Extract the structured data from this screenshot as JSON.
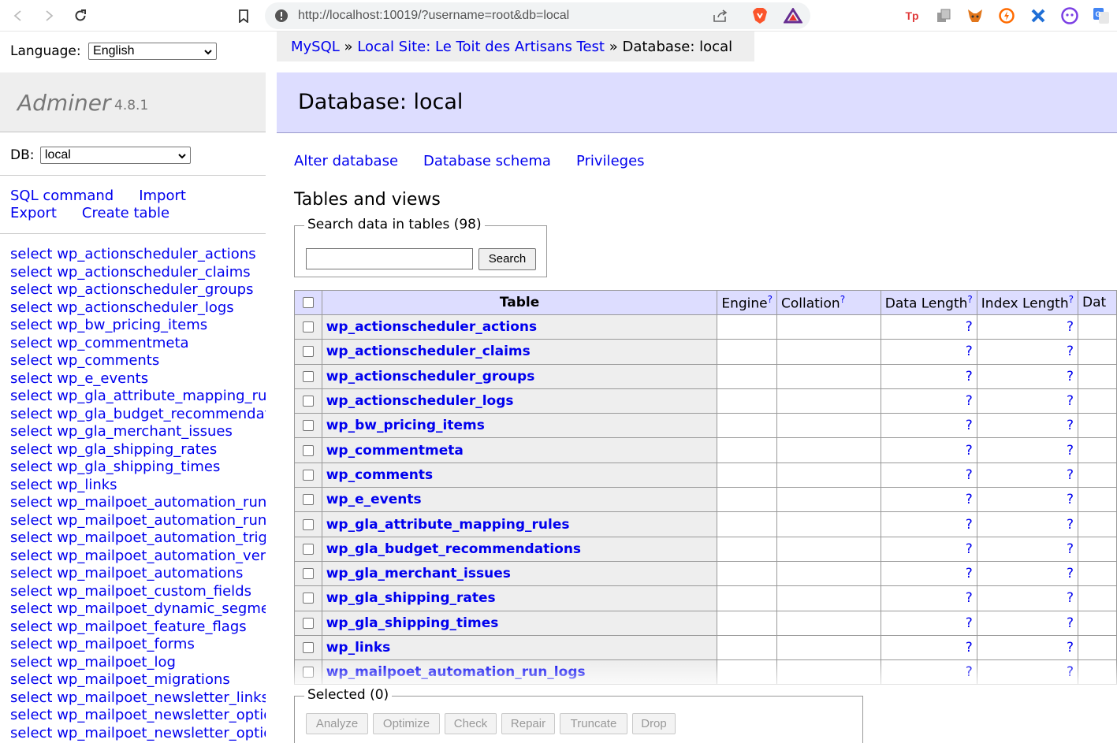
{
  "browser": {
    "url": "http://localhost:10019/?username=root&db=local",
    "extensions": [
      {
        "name": "tp-extension-icon",
        "text": "Tp",
        "color": "#e03a3a"
      },
      {
        "name": "copy-extension-icon",
        "text": "",
        "color": "#8a8a8a"
      },
      {
        "name": "metamask-icon",
        "text": "",
        "color": "#e2761b"
      },
      {
        "name": "orange-extension-icon",
        "text": "",
        "color": "#ff6b00"
      },
      {
        "name": "blue-x-extension-icon",
        "text": "",
        "color": "#1f6fd6"
      },
      {
        "name": "purple-extension-icon",
        "text": "",
        "color": "#7b3fe4"
      },
      {
        "name": "google-translate-icon",
        "text": "",
        "color": "#4285f4"
      }
    ]
  },
  "sidebar": {
    "language_label": "Language:",
    "language_value": "English",
    "app_name": "Adminer",
    "app_version": "4.8.1",
    "db_label": "DB:",
    "db_value": "local",
    "links": {
      "sql_command": "SQL command",
      "import": "Import",
      "export": "Export",
      "create_table": "Create table"
    },
    "select_links": [
      "select wp_actionscheduler_actions",
      "select wp_actionscheduler_claims",
      "select wp_actionscheduler_groups",
      "select wp_actionscheduler_logs",
      "select wp_bw_pricing_items",
      "select wp_commentmeta",
      "select wp_comments",
      "select wp_e_events",
      "select wp_gla_attribute_mapping_rules",
      "select wp_gla_budget_recommendations",
      "select wp_gla_merchant_issues",
      "select wp_gla_shipping_rates",
      "select wp_gla_shipping_times",
      "select wp_links",
      "select wp_mailpoet_automation_run_logs",
      "select wp_mailpoet_automation_runs",
      "select wp_mailpoet_automation_triggers",
      "select wp_mailpoet_automation_versions",
      "select wp_mailpoet_automations",
      "select wp_mailpoet_custom_fields",
      "select wp_mailpoet_dynamic_segment_filters",
      "select wp_mailpoet_feature_flags",
      "select wp_mailpoet_forms",
      "select wp_mailpoet_log",
      "select wp_mailpoet_migrations",
      "select wp_mailpoet_newsletter_links",
      "select wp_mailpoet_newsletter_option",
      "select wp_mailpoet_newsletter_option_fields"
    ]
  },
  "breadcrumb": {
    "mysql": "MySQL",
    "sep": "»",
    "site": "Local Site: Le Toit des Artisans Test",
    "current": "Database: local"
  },
  "main": {
    "title": "Database: local",
    "actions": {
      "alter": "Alter database",
      "schema": "Database schema",
      "privileges": "Privileges"
    },
    "tables_heading": "Tables and views",
    "search_legend": "Search data in tables (98)",
    "search_button": "Search",
    "columns": {
      "table": "Table",
      "engine": "Engine",
      "collation": "Collation",
      "data_length": "Data Length",
      "index_length": "Index Length",
      "data_free": "Dat",
      "help": "?"
    },
    "tables": [
      "wp_actionscheduler_actions",
      "wp_actionscheduler_claims",
      "wp_actionscheduler_groups",
      "wp_actionscheduler_logs",
      "wp_bw_pricing_items",
      "wp_commentmeta",
      "wp_comments",
      "wp_e_events",
      "wp_gla_attribute_mapping_rules",
      "wp_gla_budget_recommendations",
      "wp_gla_merchant_issues",
      "wp_gla_shipping_rates",
      "wp_gla_shipping_times",
      "wp_links",
      "wp_mailpoet_automation_run_logs"
    ],
    "cell_unknown": "?",
    "selected_legend": "Selected (0)",
    "bulk_buttons": [
      "Analyze",
      "Optimize",
      "Check",
      "Repair",
      "Truncate",
      "Drop"
    ]
  }
}
